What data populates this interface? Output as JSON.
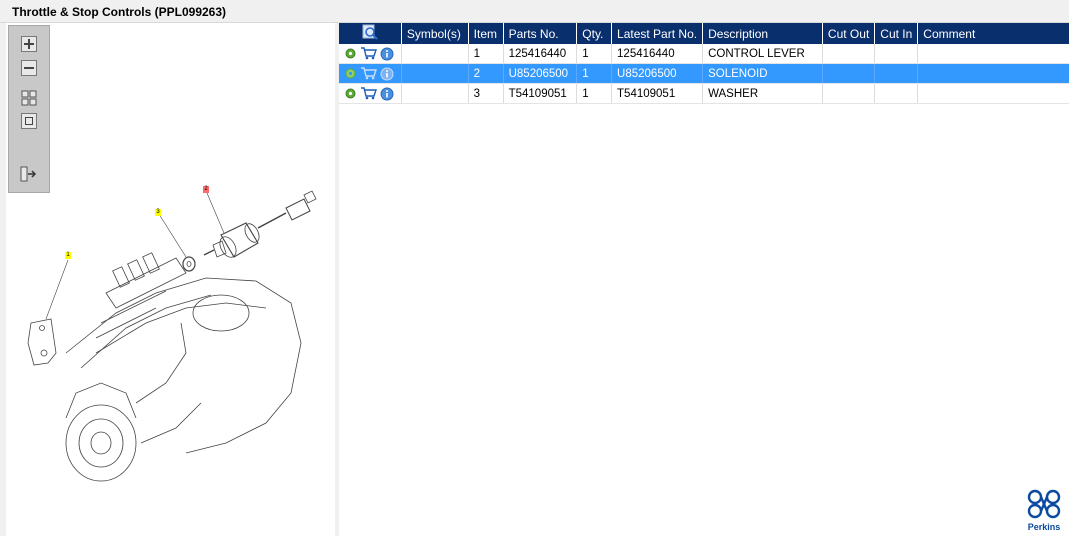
{
  "title": "Throttle & Stop Controls (PPL099263)",
  "toolbar": {
    "buttons": [
      "zoom-in-icon",
      "zoom-out-icon",
      "fit-all-icon",
      "fit-page-icon",
      "export-icon"
    ]
  },
  "diagram": {
    "callouts": [
      "1",
      "3",
      "2"
    ]
  },
  "table": {
    "columns": [
      "Symbol(s)",
      "Item",
      "Parts No.",
      "Qty.",
      "Latest Part No.",
      "Description",
      "Cut Out",
      "Cut In",
      "Comment"
    ],
    "rows": [
      {
        "item": "1",
        "part_no": "125416440",
        "qty": "1",
        "latest": "125416440",
        "desc": "CONTROL LEVER",
        "cut_out": "",
        "cut_in": "",
        "comment": "",
        "selected": false
      },
      {
        "item": "2",
        "part_no": "U85206500",
        "qty": "1",
        "latest": "U85206500",
        "desc": "SOLENOID",
        "cut_out": "",
        "cut_in": "",
        "comment": "",
        "selected": true
      },
      {
        "item": "3",
        "part_no": "T54109051",
        "qty": "1",
        "latest": "T54109051",
        "desc": "WASHER",
        "cut_out": "",
        "cut_in": "",
        "comment": "",
        "selected": false
      }
    ]
  },
  "brand": {
    "name": "Perkins"
  },
  "colors": {
    "header": "#0a2f6d",
    "selection": "#3399ff",
    "callout_yellow": "#ffff00",
    "callout_red": "#ff6b6b"
  }
}
